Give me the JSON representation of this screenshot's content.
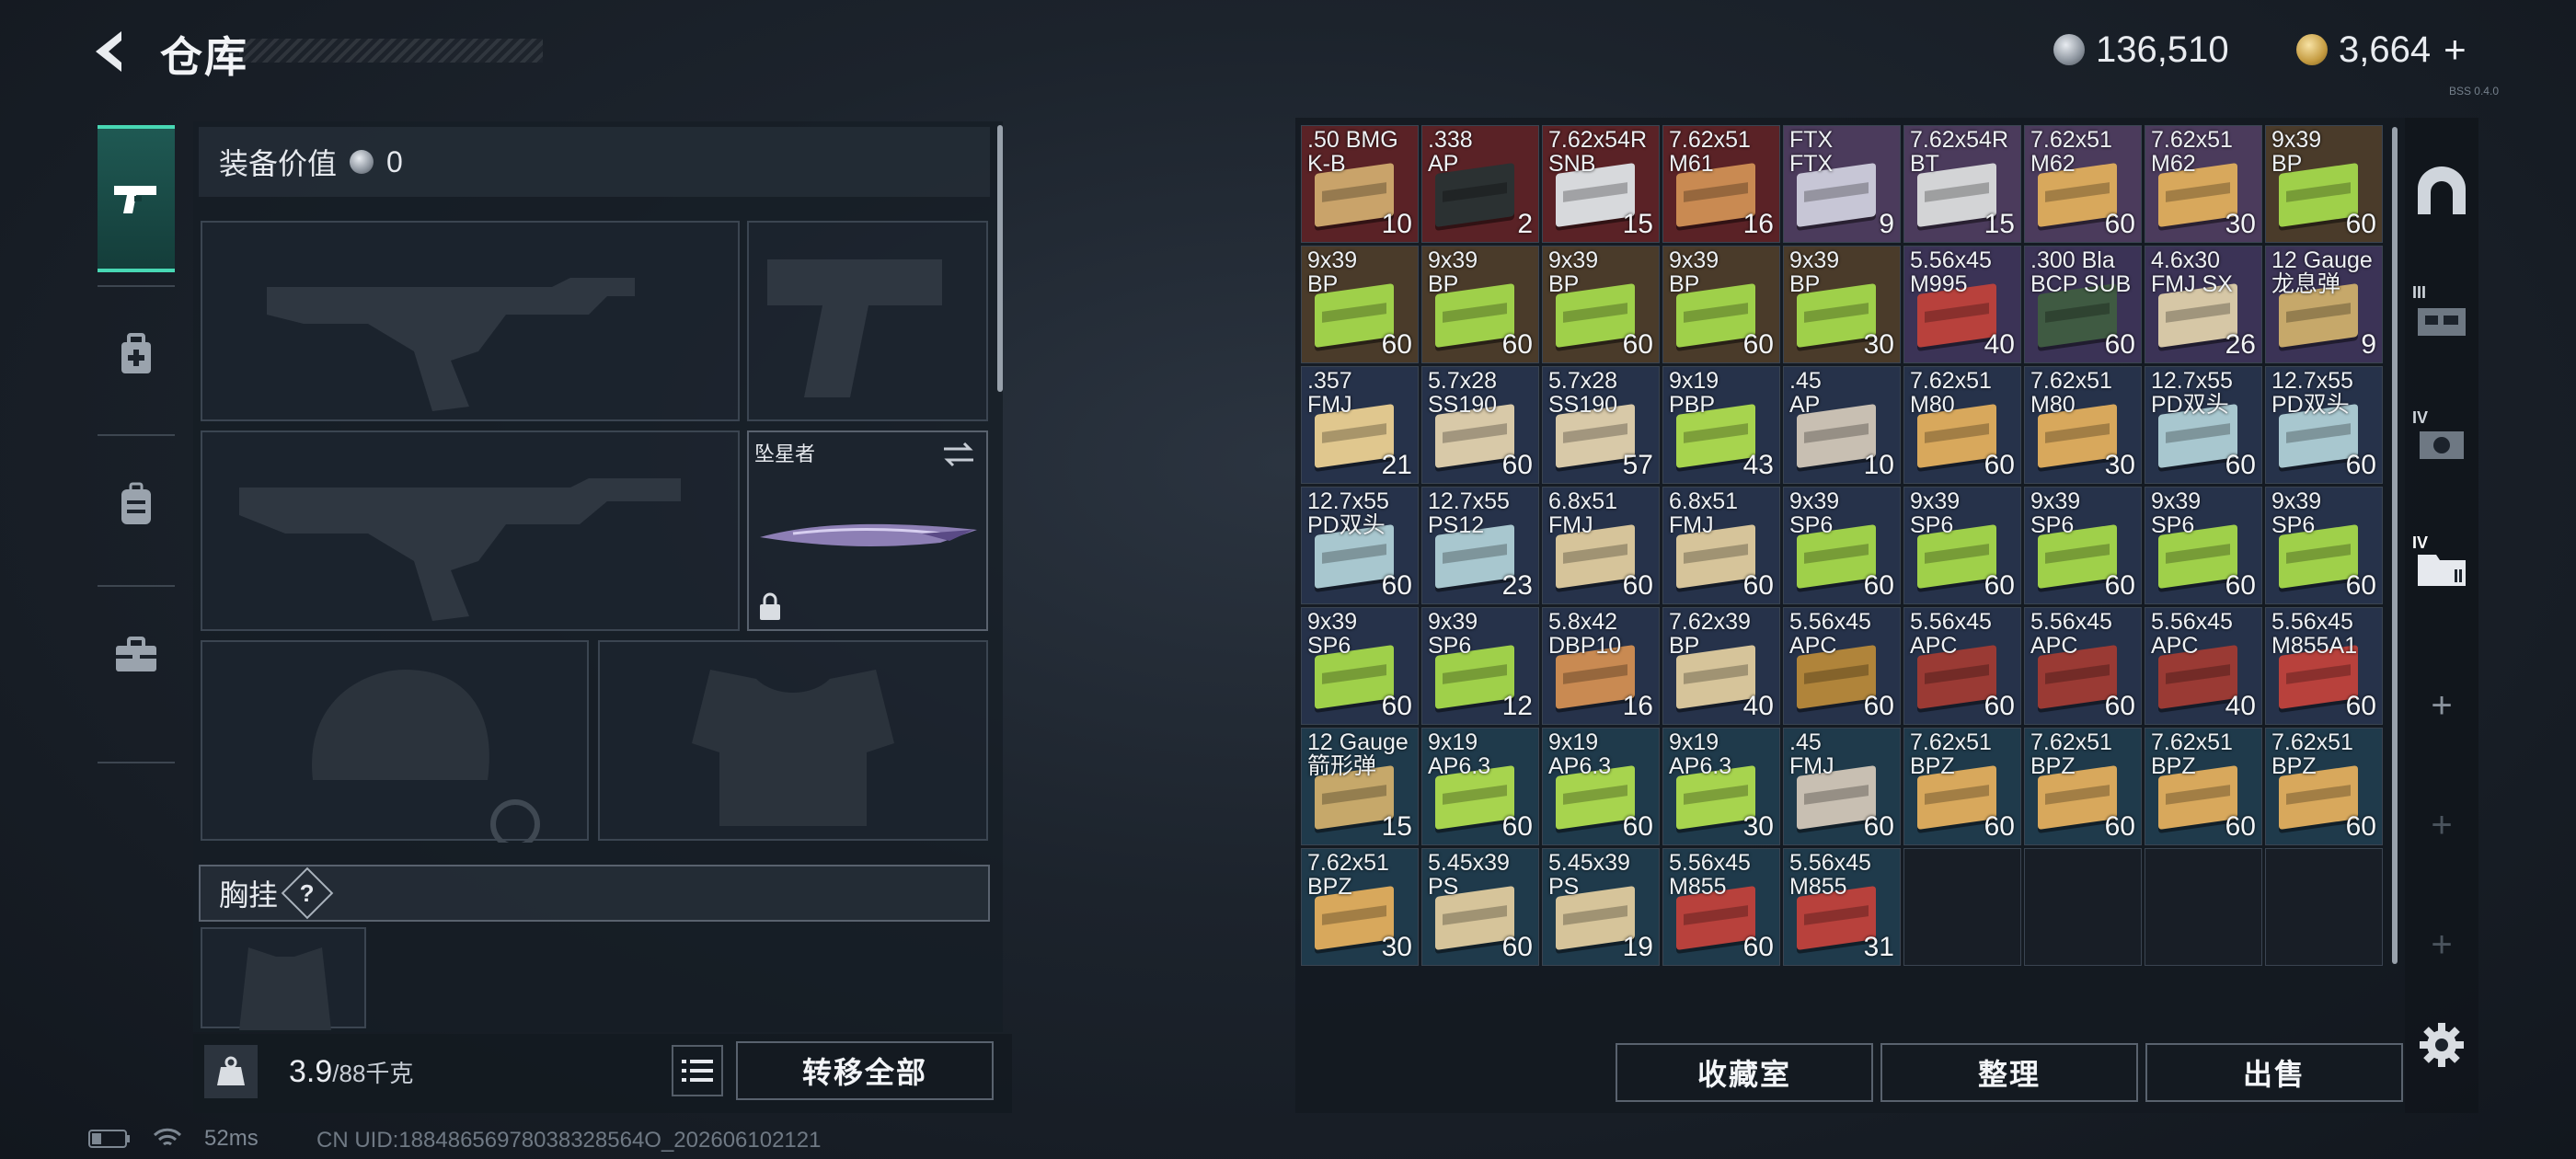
{
  "header": {
    "title": "仓库",
    "currency_a": "136,510",
    "currency_b": "3,664",
    "plus": "+",
    "tiny_code": "BSS 0.4.0"
  },
  "left_panel": {
    "equip_value_label": "装备价值",
    "equip_value": "0",
    "melee_name": "坠星者",
    "rig_label": "胸挂",
    "rig_help": "?",
    "weight_value": "3.9",
    "weight_max": "/88千克",
    "transfer_all": "转移全部"
  },
  "storage": {
    "items": [
      {
        "label": ".50 BMG\nK-B",
        "count": "10",
        "bg": "#5a2226",
        "box": "#c9a36a"
      },
      {
        "label": ".338\nAP",
        "count": "2",
        "bg": "#5a2226",
        "box": "#2b3132"
      },
      {
        "label": "7.62x54R\nSNB",
        "count": "15",
        "bg": "#5a2226",
        "box": "#d7d9dc"
      },
      {
        "label": "7.62x51\nM61",
        "count": "16",
        "bg": "#5a2226",
        "box": "#c98a52"
      },
      {
        "label": "FTX\nFTX",
        "count": "9",
        "bg": "#4b3b5c",
        "box": "#c7c6d6"
      },
      {
        "label": "7.62x54R\nBT",
        "count": "15",
        "bg": "#4b3b5c",
        "box": "#d3d4d6"
      },
      {
        "label": "7.62x51\nM62",
        "count": "60",
        "bg": "#4b3b5c",
        "box": "#d8a85c"
      },
      {
        "label": "7.62x51\nM62",
        "count": "30",
        "bg": "#4b3b5c",
        "box": "#d8a85c"
      },
      {
        "label": "9x39\nBP",
        "count": "60",
        "bg": "#4a3b2a",
        "box": "#9fd04a"
      },
      {
        "label": "9x39\nBP",
        "count": "60",
        "bg": "#4a3b2a",
        "box": "#9fd04a"
      },
      {
        "label": "9x39\nBP",
        "count": "60",
        "bg": "#4a3b2a",
        "box": "#9fd04a"
      },
      {
        "label": "9x39\nBP",
        "count": "60",
        "bg": "#4a3b2a",
        "box": "#9fd04a"
      },
      {
        "label": "9x39\nBP",
        "count": "60",
        "bg": "#4a3b2a",
        "box": "#9fd04a"
      },
      {
        "label": "9x39\nBP",
        "count": "30",
        "bg": "#4a3b2a",
        "box": "#9fd04a"
      },
      {
        "label": "5.56x45\nM995",
        "count": "40",
        "bg": "#3b3356",
        "box": "#b8413c"
      },
      {
        "label": ".300 Bla\nBCP SUB",
        "count": "60",
        "bg": "#3b3356",
        "box": "#3f5a42"
      },
      {
        "label": "4.6x30\nFMJ SX",
        "count": "26",
        "bg": "#3b3356",
        "box": "#d6c7a6"
      },
      {
        "label": "12 Gauge\n龙息弹",
        "count": "9",
        "bg": "#3b3356",
        "box": "#c6a86a"
      },
      {
        "label": ".357\nFMJ",
        "count": "21",
        "bg": "#26324a",
        "box": "#e0c78e"
      },
      {
        "label": "5.7x28\nSS190",
        "count": "60",
        "bg": "#26324a",
        "box": "#d8c9a8"
      },
      {
        "label": "5.7x28\nSS190",
        "count": "57",
        "bg": "#26324a",
        "box": "#d8c9a8"
      },
      {
        "label": "9x19\nPBP",
        "count": "43",
        "bg": "#26324a",
        "box": "#a7d44e"
      },
      {
        "label": ".45\nAP",
        "count": "10",
        "bg": "#26324a",
        "box": "#c8bfb2"
      },
      {
        "label": "7.62x51\nM80",
        "count": "60",
        "bg": "#26324a",
        "box": "#d8a85c"
      },
      {
        "label": "7.62x51\nM80",
        "count": "30",
        "bg": "#26324a",
        "box": "#d8a85c"
      },
      {
        "label": "12.7x55\nPD双头",
        "count": "60",
        "bg": "#26324a",
        "box": "#a8c7cf"
      },
      {
        "label": "12.7x55\nPD双头",
        "count": "60",
        "bg": "#26324a",
        "box": "#a8c7cf"
      },
      {
        "label": "12.7x55\nPD双头",
        "count": "60",
        "bg": "#26324a",
        "box": "#a8c7cf"
      },
      {
        "label": "12.7x55\nPS12",
        "count": "23",
        "bg": "#26324a",
        "box": "#a8c7cf"
      },
      {
        "label": "6.8x51\nFMJ",
        "count": "60",
        "bg": "#26324a",
        "box": "#d6c49a"
      },
      {
        "label": "6.8x51\nFMJ",
        "count": "60",
        "bg": "#26324a",
        "box": "#d6c49a"
      },
      {
        "label": "9x39\nSP6",
        "count": "60",
        "bg": "#26324a",
        "box": "#9fd04a"
      },
      {
        "label": "9x39\nSP6",
        "count": "60",
        "bg": "#26324a",
        "box": "#9fd04a"
      },
      {
        "label": "9x39\nSP6",
        "count": "60",
        "bg": "#26324a",
        "box": "#9fd04a"
      },
      {
        "label": "9x39\nSP6",
        "count": "60",
        "bg": "#26324a",
        "box": "#9fd04a"
      },
      {
        "label": "9x39\nSP6",
        "count": "60",
        "bg": "#26324a",
        "box": "#9fd04a"
      },
      {
        "label": "9x39\nSP6",
        "count": "60",
        "bg": "#26324a",
        "box": "#9fd04a"
      },
      {
        "label": "9x39\nSP6",
        "count": "12",
        "bg": "#26324a",
        "box": "#9fd04a"
      },
      {
        "label": "5.8x42\nDBP10",
        "count": "16",
        "bg": "#26324a",
        "box": "#c98a52"
      },
      {
        "label": "7.62x39\nBP",
        "count": "40",
        "bg": "#26324a",
        "box": "#d6c49a"
      },
      {
        "label": "5.56x45\nAPC",
        "count": "60",
        "bg": "#26324a",
        "box": "#b0843a"
      },
      {
        "label": "5.56x45\nAPC",
        "count": "60",
        "bg": "#26324a",
        "box": "#9a3a34"
      },
      {
        "label": "5.56x45\nAPC",
        "count": "60",
        "bg": "#26324a",
        "box": "#9a3a34"
      },
      {
        "label": "5.56x45\nAPC",
        "count": "40",
        "bg": "#26324a",
        "box": "#9a3a34"
      },
      {
        "label": "5.56x45\nM855A1",
        "count": "60",
        "bg": "#26324a",
        "box": "#b8413c"
      },
      {
        "label": "12 Gauge\n箭形弹",
        "count": "15",
        "bg": "#1f3a4b",
        "box": "#c6a86a"
      },
      {
        "label": "9x19\nAP6.3",
        "count": "60",
        "bg": "#1f3a4b",
        "box": "#a7d44e"
      },
      {
        "label": "9x19\nAP6.3",
        "count": "60",
        "bg": "#1f3a4b",
        "box": "#a7d44e"
      },
      {
        "label": "9x19\nAP6.3",
        "count": "30",
        "bg": "#1f3a4b",
        "box": "#a7d44e"
      },
      {
        "label": ".45\nFMJ",
        "count": "60",
        "bg": "#1f3a4b",
        "box": "#c8bfb2"
      },
      {
        "label": "7.62x51\nBPZ",
        "count": "60",
        "bg": "#1f3a4b",
        "box": "#d8a85c"
      },
      {
        "label": "7.62x51\nBPZ",
        "count": "60",
        "bg": "#1f3a4b",
        "box": "#d8a85c"
      },
      {
        "label": "7.62x51\nBPZ",
        "count": "60",
        "bg": "#1f3a4b",
        "box": "#d8a85c"
      },
      {
        "label": "7.62x51\nBPZ",
        "count": "60",
        "bg": "#1f3a4b",
        "box": "#d8a85c"
      },
      {
        "label": "7.62x51\nBPZ",
        "count": "30",
        "bg": "#1f3a4b",
        "box": "#d8a85c"
      },
      {
        "label": "5.45x39\nPS",
        "count": "60",
        "bg": "#1f3a4b",
        "box": "#d6c49a"
      },
      {
        "label": "5.45x39\nPS",
        "count": "19",
        "bg": "#1f3a4b",
        "box": "#d6c49a"
      },
      {
        "label": "5.56x45\nM855",
        "count": "60",
        "bg": "#1f3a4b",
        "box": "#b8413c"
      },
      {
        "label": "5.56x45\nM855",
        "count": "31",
        "bg": "#1f3a4b",
        "box": "#b8413c"
      }
    ],
    "collection_label": "收藏室",
    "sort_label": "整理",
    "sell_label": "出售"
  },
  "right_rail": {
    "tab_labels": [
      "III",
      "IV",
      "IV"
    ],
    "plus": "+"
  },
  "status_bar": {
    "ping": "52ms",
    "uid": "CN UID:18848656978038328564O_202606102121"
  },
  "colors": {
    "accent": "#48d8b4",
    "panel": "#161d25",
    "border": "#3a4451"
  }
}
